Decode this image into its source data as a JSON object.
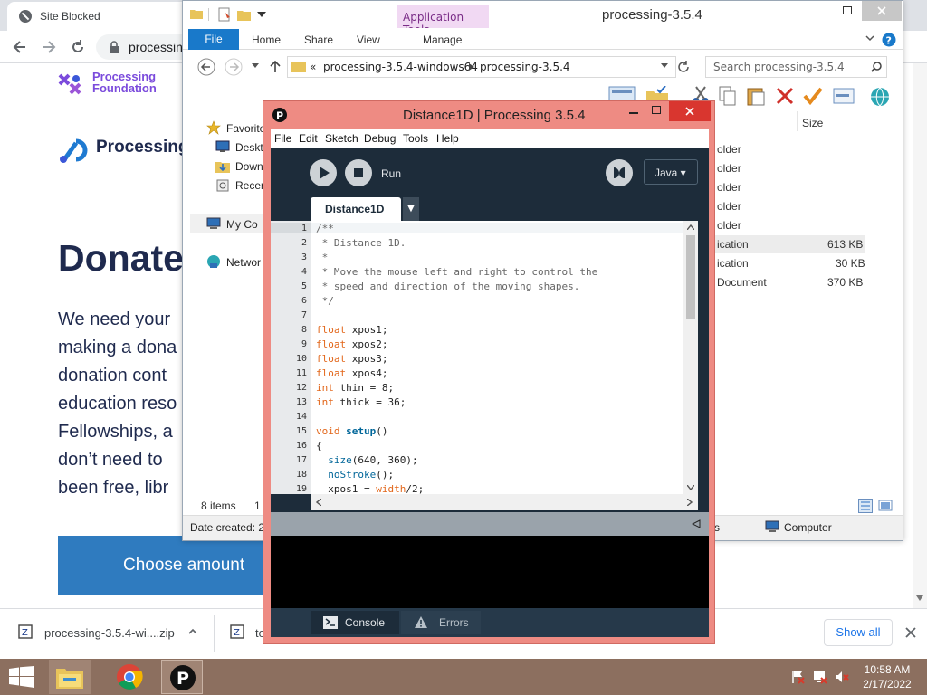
{
  "browser": {
    "tab_title": "Site Blocked",
    "url_partial": "processin",
    "org_name_line1": "Processing",
    "org_name_line2": "Foundation",
    "site_title": "Processing",
    "heading": "Donate",
    "paragraph_lines": [
      "We need your",
      "making a dona",
      "donation cont",
      "education reso",
      "Fellowships, a",
      "don’t need to",
      "been free, libr"
    ],
    "choose_amount": "Choose amount"
  },
  "downloads": {
    "item1": "processing-3.5.4-wi....zip",
    "item2": "to",
    "show_all": "Show all"
  },
  "explorer": {
    "title": "processing-3.5.4",
    "context_tab": "Application Tools",
    "ribbon_tabs": [
      "File",
      "Home",
      "Share",
      "View",
      "Manage"
    ],
    "address_prefix": "«",
    "address_part1": "processing-3.5.4-windows64",
    "address_part2": "processing-3.5.4",
    "search_placeholder": "Search processing-3.5.4",
    "nav": {
      "favorites": "Favorite",
      "desktop": "Deskto",
      "downloads": "Down",
      "recent": "Recen",
      "computer": "My Co",
      "network": "Networ"
    },
    "column_size": "Size",
    "files": [
      {
        "type": "older",
        "size": ""
      },
      {
        "type": "older",
        "size": ""
      },
      {
        "type": "older",
        "size": ""
      },
      {
        "type": "older",
        "size": ""
      },
      {
        "type": "older",
        "size": ""
      },
      {
        "type": "ication",
        "size": "613 KB"
      },
      {
        "type": "ication",
        "size": "30 KB"
      },
      {
        "type": "Document",
        "size": "370 KB"
      }
    ],
    "items_count": "8 items",
    "status_extra": "1",
    "date_created": "Date created: 2,",
    "computer": "Computer",
    "details_letter": "s"
  },
  "pde": {
    "title": "Distance1D | Processing 3.5.4",
    "menu": [
      "File",
      "Edit",
      "Sketch",
      "Debug",
      "Tools",
      "Help"
    ],
    "run_label": "Run",
    "mode": "Java ▾",
    "sketch_tab": "Distance1D",
    "console_tab": "Console",
    "errors_tab": "Errors",
    "line_numbers": [
      "1",
      "2",
      "3",
      "4",
      "5",
      "6",
      "7",
      "8",
      "9",
      "10",
      "11",
      "12",
      "13",
      "14",
      "15",
      "16",
      "17",
      "18",
      "19"
    ],
    "code": {
      "l1": "/**",
      "l2": " * Distance 1D.",
      "l3": " *",
      "l4": " * Move the mouse left and right to control the",
      "l5": " * speed and direction of the moving shapes.",
      "l6": " */",
      "l8_kw": "float",
      "l8_rest": " xpos1;",
      "l9_kw": "float",
      "l9_rest": " xpos2;",
      "l10_kw": "float",
      "l10_rest": " xpos3;",
      "l11_kw": "float",
      "l11_rest": " xpos4;",
      "l12_kw": "int",
      "l12_rest": " thin = 8;",
      "l13_kw": "int",
      "l13_rest": " thick = 36;",
      "l15_kw": "void",
      "l15_fn": "setup",
      "l15_rest": "()",
      "l16": "{",
      "l17_fn": "size",
      "l17_rest": "(640, 360);",
      "l18_fn": "noStroke",
      "l18_rest": "();",
      "l19_a": "xpos1 = ",
      "l19_kw": "width",
      "l19_b": "/2;"
    }
  },
  "taskbar": {
    "time": "10:58 AM",
    "date": "2/17/2022"
  }
}
